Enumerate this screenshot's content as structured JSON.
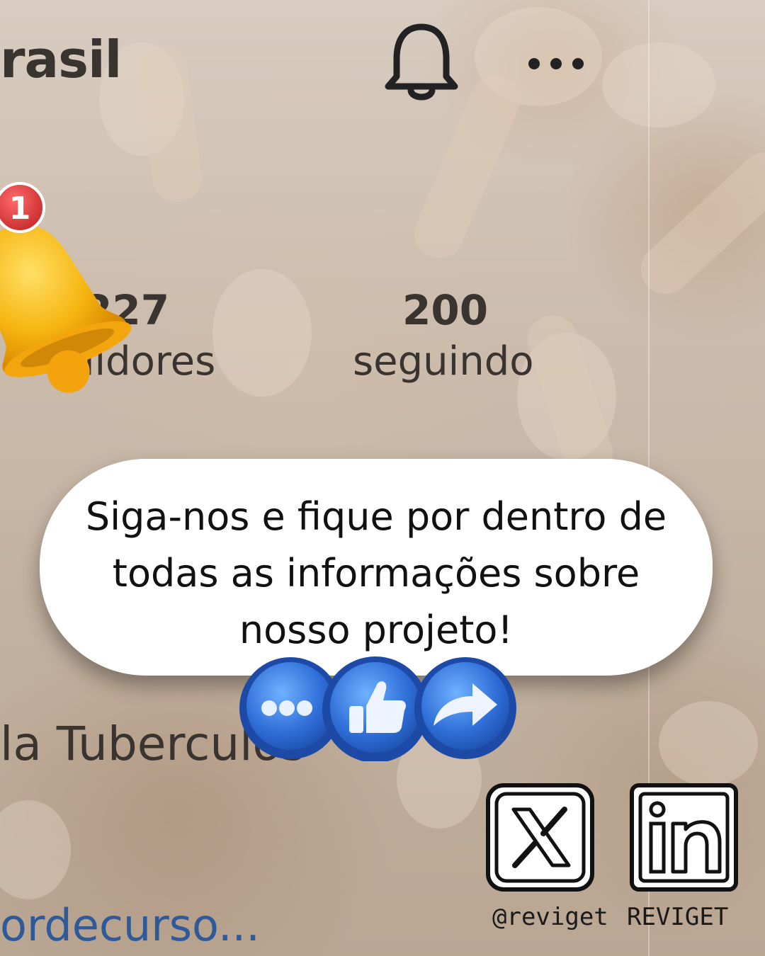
{
  "header": {
    "profile_name": "rasil",
    "bell_icon": "bell-outline-icon",
    "more_icon": "more-horizontal-icon"
  },
  "stats": {
    "followers_count": "227",
    "followers_label": "uidores",
    "following_count": "200",
    "following_label": "seguindo"
  },
  "bio": {
    "text": "la Tuberculos"
  },
  "link": {
    "text": "ordecurso..."
  },
  "notification_bell": {
    "icon": "bell-3d-icon",
    "badge_count": "1"
  },
  "cta": {
    "message": "Siga-nos e fique por dentro de\ntodas as informações sobre\nnosso projeto!"
  },
  "reaction_coins": [
    {
      "icon": "ellipsis-icon"
    },
    {
      "icon": "thumbs-up-icon"
    },
    {
      "icon": "share-arrow-icon"
    }
  ],
  "social": {
    "x": {
      "icon": "x-logo-icon",
      "handle": "@reviget"
    },
    "linkedin": {
      "icon": "linkedin-logo-icon",
      "handle": "REVIGET"
    }
  },
  "colors": {
    "background": "#cbbcad",
    "bubble": "#ffffff",
    "coin_blue": "#2f6fd8",
    "bell_yellow": "#f6b511",
    "badge_red": "#e53935",
    "link_blue": "#2f5a9a"
  }
}
